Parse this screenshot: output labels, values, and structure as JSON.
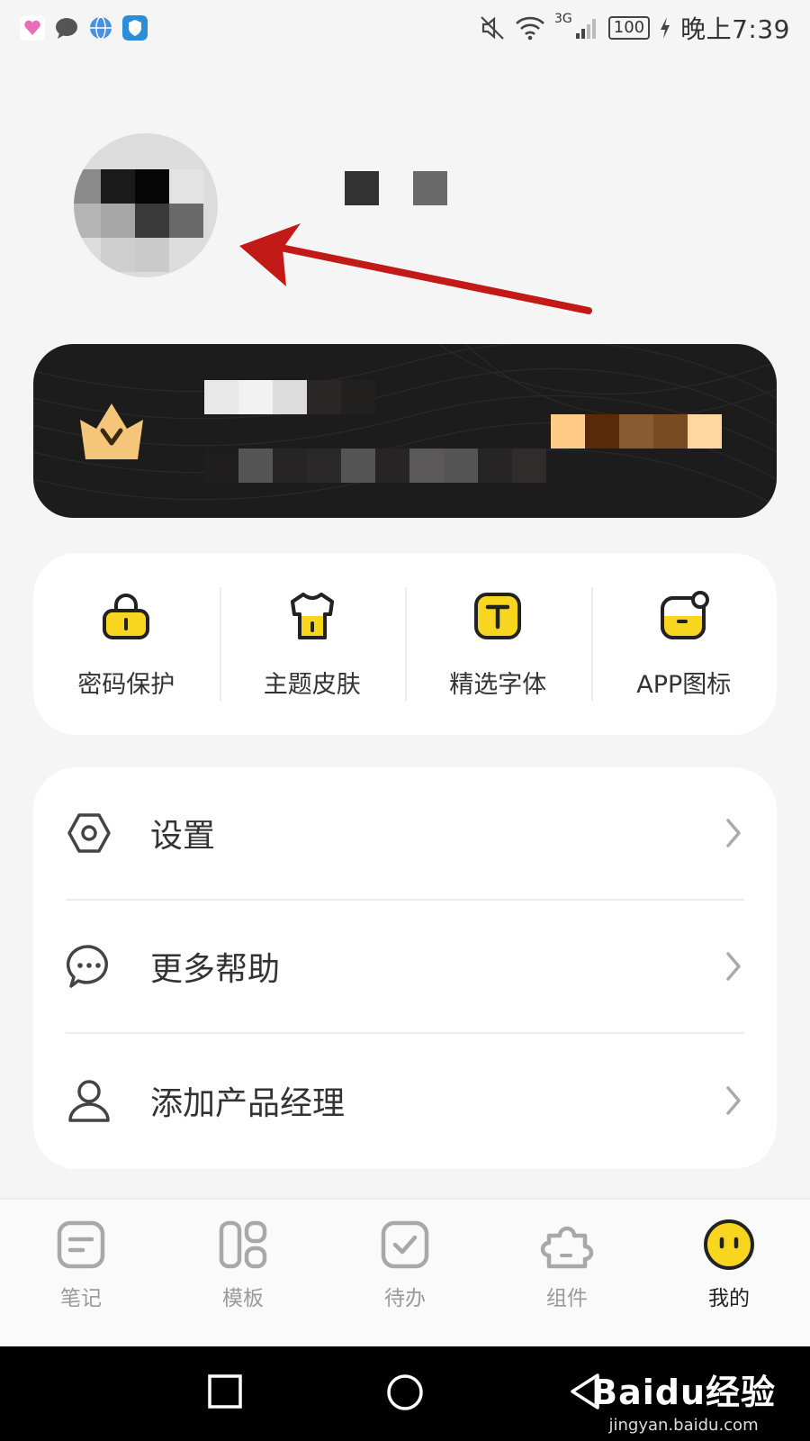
{
  "status_bar": {
    "time": "晚上7:39",
    "battery": "100",
    "network": "3G"
  },
  "quick_actions": [
    {
      "label": "密码保护",
      "icon": "lock-icon"
    },
    {
      "label": "主题皮肤",
      "icon": "tshirt-icon"
    },
    {
      "label": "精选字体",
      "icon": "font-icon"
    },
    {
      "label": "APP图标",
      "icon": "app-icon"
    }
  ],
  "menu": [
    {
      "label": "设置",
      "icon": "settings-icon"
    },
    {
      "label": "更多帮助",
      "icon": "help-chat-icon"
    },
    {
      "label": "添加产品经理",
      "icon": "person-icon"
    }
  ],
  "tabs": [
    {
      "label": "笔记",
      "icon": "note-icon",
      "active": false
    },
    {
      "label": "模板",
      "icon": "template-icon",
      "active": false
    },
    {
      "label": "待办",
      "icon": "todo-icon",
      "active": false
    },
    {
      "label": "组件",
      "icon": "widget-icon",
      "active": false
    },
    {
      "label": "我的",
      "icon": "smiley-icon",
      "active": true
    }
  ],
  "watermark": {
    "logo_text": "Baidu经验",
    "url": "jingyan.baidu.com"
  },
  "colors": {
    "accent_yellow": "#f8d51f",
    "vip_gold": "#f5c67a",
    "arrow_red": "#c21a17",
    "banner_dark": "#1d1c1c"
  }
}
